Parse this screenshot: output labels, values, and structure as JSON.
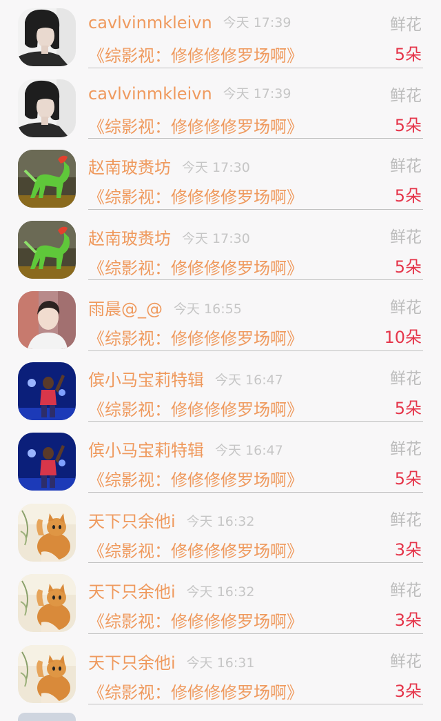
{
  "records": [
    {
      "avatar": "woman-portrait-avatar",
      "name": "cavlvinmkleivn",
      "time": "今天 17:39",
      "gift": "鲜花",
      "title": "《综影视：修修修修罗场啊》",
      "count": "5朵"
    },
    {
      "avatar": "woman-portrait-avatar",
      "name": "cavlvinmkleivn",
      "time": "今天 17:39",
      "gift": "鲜花",
      "title": "《综影视：修修修修罗场啊》",
      "count": "5朵"
    },
    {
      "avatar": "jade-horse-avatar",
      "name": "赵南玻赉坊",
      "time": "今天 17:30",
      "gift": "鲜花",
      "title": "《综影视：修修修修罗场啊》",
      "count": "5朵"
    },
    {
      "avatar": "jade-horse-avatar",
      "name": "赵南玻赉坊",
      "time": "今天 17:30",
      "gift": "鲜花",
      "title": "《综影视：修修修修罗场啊》",
      "count": "5朵"
    },
    {
      "avatar": "young-man-avatar",
      "name": "雨晨@_@",
      "time": "今天 16:55",
      "gift": "鲜花",
      "title": "《综影视：修修修修罗场啊》",
      "count": "10朵"
    },
    {
      "avatar": "stage-performer-avatar",
      "name": "傧小马宝莉特辑",
      "time": "今天 16:47",
      "gift": "鲜花",
      "title": "《综影视：修修修修罗场啊》",
      "count": "5朵"
    },
    {
      "avatar": "stage-performer-avatar",
      "name": "傧小马宝莉特辑",
      "time": "今天 16:47",
      "gift": "鲜花",
      "title": "《综影视：修修修修罗场啊》",
      "count": "5朵"
    },
    {
      "avatar": "orange-kitten-avatar",
      "name": "天下只余他i",
      "time": "今天 16:32",
      "gift": "鲜花",
      "title": "《综影视：修修修修罗场啊》",
      "count": "3朵"
    },
    {
      "avatar": "orange-kitten-avatar",
      "name": "天下只余他i",
      "time": "今天 16:32",
      "gift": "鲜花",
      "title": "《综影视：修修修修罗场啊》",
      "count": "3朵"
    },
    {
      "avatar": "orange-kitten-avatar",
      "name": "天下只余他i",
      "time": "今天 16:31",
      "gift": "鲜花",
      "title": "《综影视：修修修修罗场啊》",
      "count": "3朵"
    }
  ],
  "colors": {
    "name": "#ef9a5e",
    "count": "#e5354a",
    "muted": "#c6c6c6",
    "background": "#f8f7f8"
  }
}
